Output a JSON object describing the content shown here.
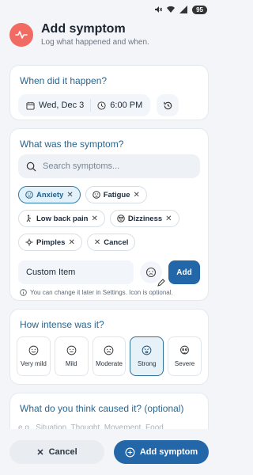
{
  "status_bar": {
    "battery": "95"
  },
  "header": {
    "title": "Add symptom",
    "subtitle": "Log what happened and when.",
    "icon": "pulse-icon"
  },
  "when": {
    "title": "When did it happen?",
    "date": "Wed, Dec 3",
    "time": "6:00 PM"
  },
  "symptom": {
    "title": "What was the symptom?",
    "search_placeholder": "Search symptoms...",
    "chips": [
      {
        "label": "Anxiety",
        "icon": "face-icon",
        "active": true
      },
      {
        "label": "Fatigue",
        "icon": "tired-face-icon"
      },
      {
        "label": "Low back pain",
        "icon": "back-pain-icon"
      },
      {
        "label": "Dizziness",
        "icon": "dizzy-face-icon"
      },
      {
        "label": "Pimples",
        "icon": "pimple-icon"
      },
      {
        "label": "Cancel",
        "icon": "close-icon"
      }
    ],
    "custom_value": "Custom Item",
    "add_label": "Add",
    "hint": "You can change it later in Settings. Icon is optional."
  },
  "intensity": {
    "title": "How intense was it?",
    "levels": [
      {
        "label": "Very mild"
      },
      {
        "label": "Mild"
      },
      {
        "label": "Moderate"
      },
      {
        "label": "Strong",
        "active": true
      },
      {
        "label": "Severe"
      }
    ]
  },
  "cause": {
    "title": "What do you think caused it? (optional)",
    "placeholder": "e.g., Situation, Thought, Movement, Food"
  },
  "footer": {
    "cancel_label": "Cancel",
    "add_label": "Add symptom"
  },
  "colors": {
    "accent": "#2467a8",
    "header_badge": "#f26b63",
    "title_blue": "#27668f"
  }
}
